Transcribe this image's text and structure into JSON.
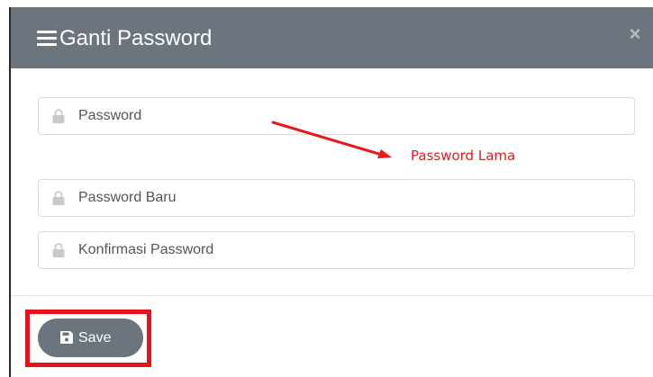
{
  "dialog": {
    "title": "Ganti Password",
    "close_label": "×"
  },
  "fields": [
    {
      "placeholder": "Password",
      "value": ""
    },
    {
      "placeholder": "Password Baru",
      "value": ""
    },
    {
      "placeholder": "Konfirmasi Password",
      "value": ""
    }
  ],
  "annotation": {
    "label": "Password Lama",
    "color": "#e8181c"
  },
  "footer": {
    "save_label": "Save"
  },
  "colors": {
    "header_bg": "#6c757d",
    "button_bg": "#6c757d",
    "highlight_border": "#e8131b"
  },
  "icons": {
    "header": "menu-icon",
    "close": "close-icon",
    "fields": "lock-icon",
    "save": "floppy-disk-icon"
  }
}
